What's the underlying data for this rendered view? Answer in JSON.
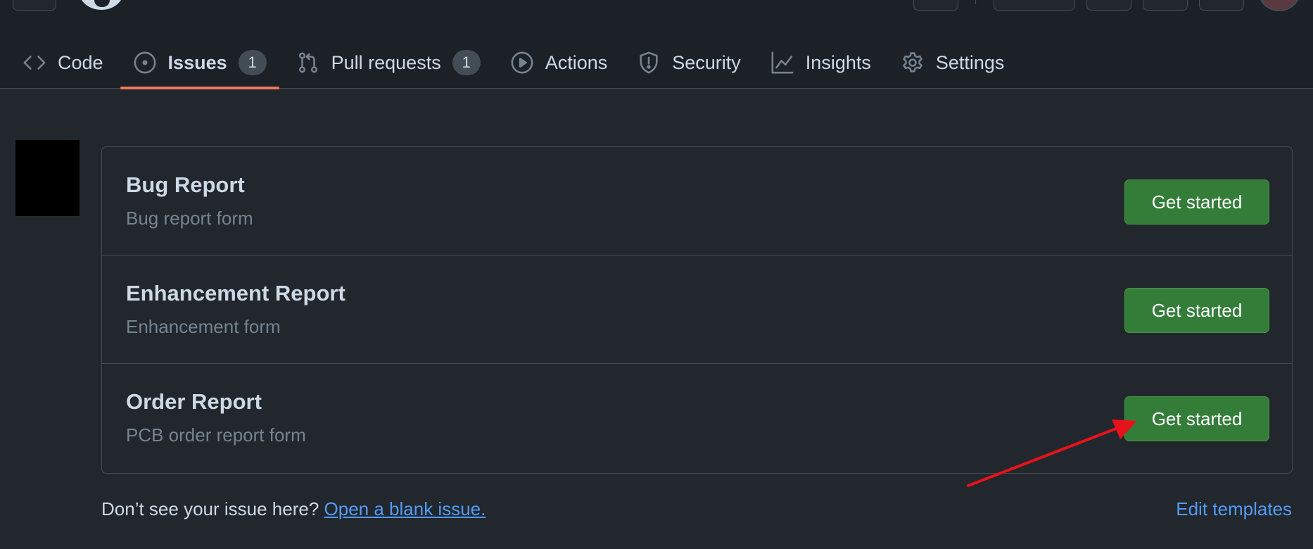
{
  "nav": {
    "tabs": [
      {
        "label": "Code",
        "icon": "code-icon"
      },
      {
        "label": "Issues",
        "icon": "issue-opened-icon",
        "count": "1",
        "selected": true
      },
      {
        "label": "Pull requests",
        "icon": "git-pull-request-icon",
        "count": "1"
      },
      {
        "label": "Actions",
        "icon": "play-icon"
      },
      {
        "label": "Security",
        "icon": "shield-icon"
      },
      {
        "label": "Insights",
        "icon": "graph-icon"
      },
      {
        "label": "Settings",
        "icon": "gear-icon"
      }
    ]
  },
  "templates": [
    {
      "name": "Bug Report",
      "description": "Bug report form",
      "button": "Get started"
    },
    {
      "name": "Enhancement Report",
      "description": "Enhancement form",
      "button": "Get started"
    },
    {
      "name": "Order Report",
      "description": "PCB order report form",
      "button": "Get started"
    }
  ],
  "footer": {
    "prompt": "Don’t see your issue here?",
    "blank_issue_link": "Open a blank issue.",
    "edit_templates_link": "Edit templates"
  },
  "colors": {
    "background": "#22272e",
    "accent_underline": "#ec775c",
    "button_green": "#347d39",
    "link_blue": "#539bf5",
    "annotation_arrow": "#e8121b"
  }
}
